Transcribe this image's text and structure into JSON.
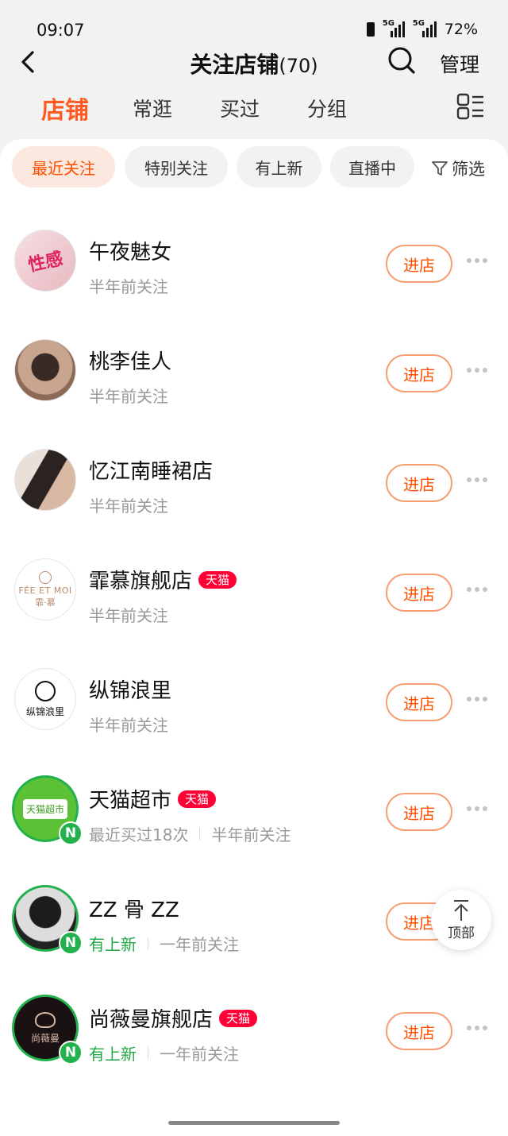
{
  "status_bar": {
    "time": "09:07",
    "battery": "72%",
    "net1": "5G",
    "net2": "5G"
  },
  "header": {
    "title": "关注店铺",
    "count": "(70)",
    "manage_label": "管理"
  },
  "tabs": [
    "店铺",
    "常逛",
    "买过",
    "分组"
  ],
  "filters": {
    "chips": [
      "最近关注",
      "特别关注",
      "有上新",
      "直播中"
    ],
    "filter_label": "筛选"
  },
  "shops": [
    {
      "name": "午夜魅女",
      "tag": "",
      "sub1": "半年前关注",
      "sub2": "",
      "avatar_text": "性感"
    },
    {
      "name": "桃李佳人",
      "tag": "",
      "sub1": "半年前关注",
      "sub2": "",
      "avatar_text": ""
    },
    {
      "name": "忆江南睡裙店",
      "tag": "",
      "sub1": "半年前关注",
      "sub2": "",
      "avatar_text": ""
    },
    {
      "name": "霏慕旗舰店",
      "tag": "天猫",
      "sub1": "半年前关注",
      "sub2": "",
      "avatar_text": "FÉE ET MOI",
      "avatar_text2": "霏·慕"
    },
    {
      "name": "纵锦浪里",
      "tag": "",
      "sub1": "半年前关注",
      "sub2": "",
      "avatar_text": "纵锦浪里"
    },
    {
      "name": "天猫超市",
      "tag": "天猫",
      "sub1": "最近买过18次",
      "sub2": "半年前关注",
      "avatar_text": "天猫超市"
    },
    {
      "name": "ZZ 骨 ZZ",
      "tag": "",
      "sub1": "有上新",
      "sub2": "一年前关注",
      "avatar_text": ""
    },
    {
      "name": "尚薇曼旗舰店",
      "tag": "天猫",
      "sub1": "有上新",
      "sub2": "一年前关注",
      "avatar_text": "尚薇曼"
    }
  ],
  "enter_label": "进店",
  "n_badge": "N",
  "to_top_label": "顶部",
  "colors": {
    "accent": "#ff5000",
    "green": "#22b14c",
    "tmall": "#ff0036"
  }
}
